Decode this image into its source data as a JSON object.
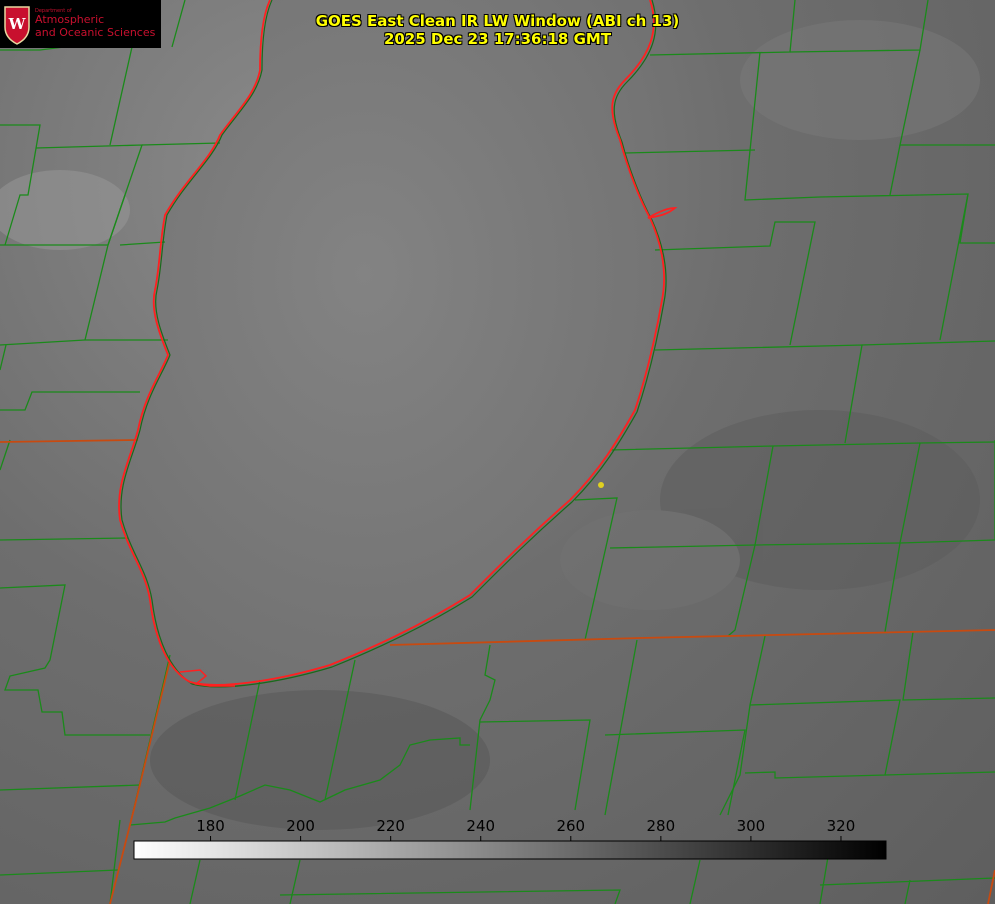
{
  "logo": {
    "dept_line": "Department of",
    "line1": "Atmospheric",
    "line2": "and Oceanic Sciences",
    "letter": "W"
  },
  "title": {
    "line1": "GOES East Clean IR LW Window (ABI ch 13)",
    "line2": "2025 Dec 23 17:36:18 GMT"
  },
  "colorbar": {
    "min": 163,
    "max": 330,
    "ticks": [
      "180",
      "200",
      "220",
      "240",
      "260",
      "280",
      "300",
      "320"
    ],
    "tick_values": [
      180,
      200,
      220,
      240,
      260,
      280,
      300,
      320
    ],
    "start_color": "#ffffff",
    "end_color": "#000000"
  },
  "colors": {
    "county_lines": "#1a8a1a",
    "lake_shore": "#ff2020",
    "state_border": "#c84a10",
    "marker": "#e0d020",
    "title_text": "#ffff00"
  }
}
